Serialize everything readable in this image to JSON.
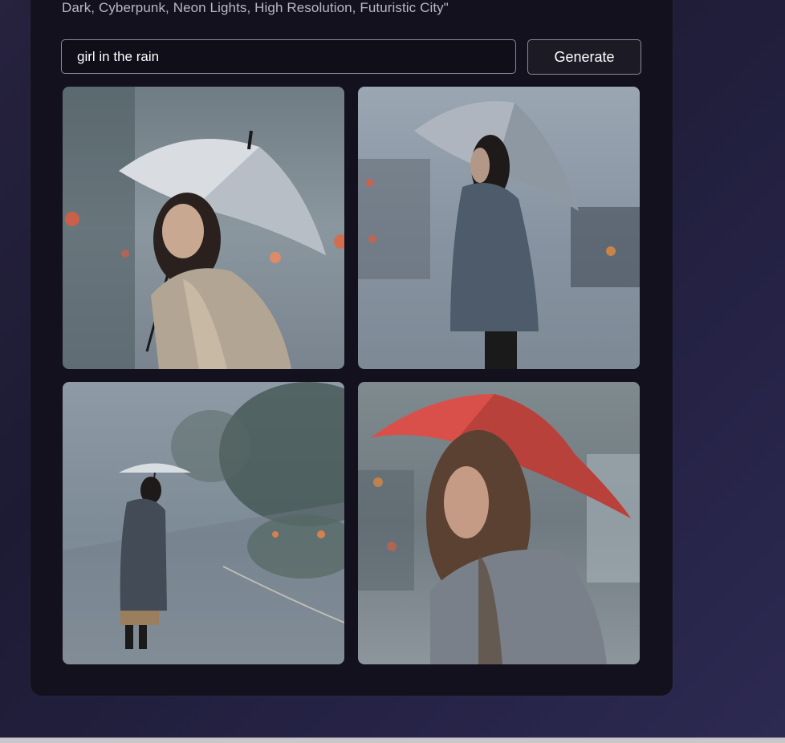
{
  "prompt_hint": "Dark, Cyberpunk, Neon Lights, High Resolution, Futuristic City\"",
  "search": {
    "value": "girl in the rain",
    "placeholder": ""
  },
  "generate_label": "Generate",
  "colors": {
    "panel": "#13111e",
    "background": "#26223f",
    "button_border": "#8b8a96",
    "umbrella_red": "#d9504a"
  }
}
